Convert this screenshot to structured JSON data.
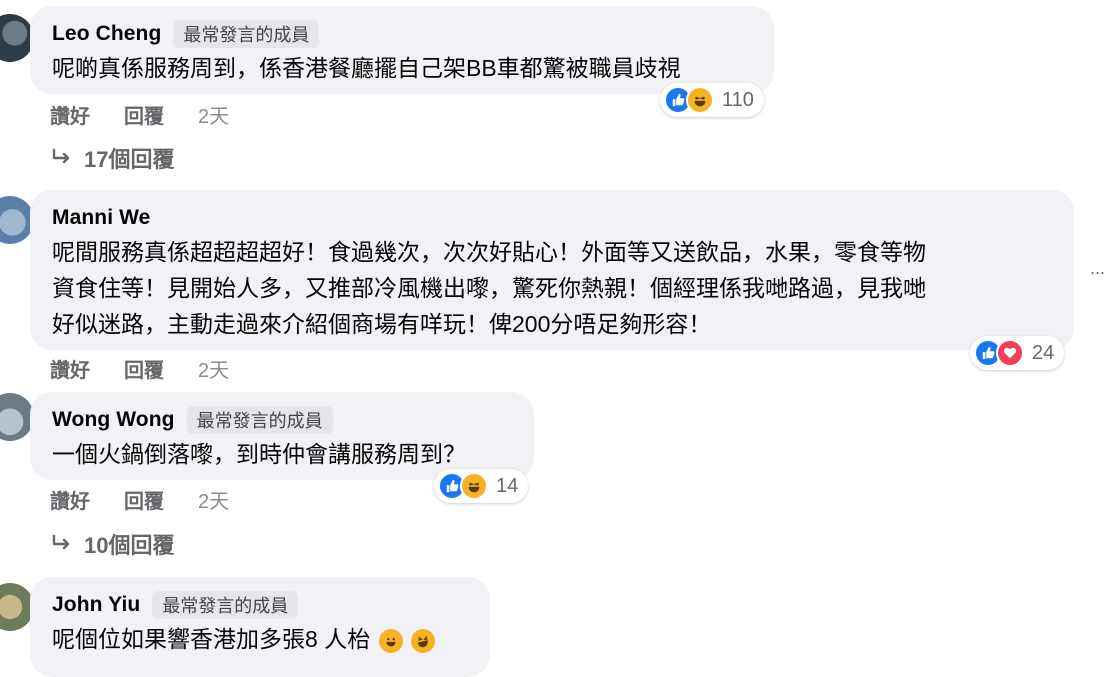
{
  "comments": [
    {
      "author": "Leo Cheng",
      "badge": "最常發言的成員",
      "text": "呢啲真係服務周到，係香港餐廳擺自己架BB車都驚被職員歧視",
      "actions": {
        "like": "讚好",
        "reply": "回覆",
        "time": "2天"
      },
      "reaction_count": "110",
      "reactions": [
        "like",
        "haha"
      ],
      "replies_label": "17個回覆"
    },
    {
      "author": "Manni We",
      "badge": "",
      "text_lines": [
        "呢間服務真係超超超超好！食過幾次，次次好貼心！外面等又送飲品，水果，零食等物",
        "資食住等！見開始人多，又推部冷風機出嚟，驚死你熱親！個經理係我哋路過，見我哋",
        "好似迷路，主動走過來介紹個商場有咩玩！俾200分唔足夠形容！"
      ],
      "actions": {
        "like": "讚好",
        "reply": "回覆",
        "time": "2天"
      },
      "reaction_count": "24",
      "reactions": [
        "like",
        "love"
      ]
    },
    {
      "author": "Wong Wong",
      "badge": "最常發言的成員",
      "text": "一個火鍋倒落嚟，到時仲會講服務周到？",
      "actions": {
        "like": "讚好",
        "reply": "回覆",
        "time": "2天"
      },
      "reaction_count": "14",
      "reactions": [
        "like",
        "haha"
      ],
      "replies_label": "10個回覆"
    },
    {
      "author": "John Yiu",
      "badge": "最常發言的成員",
      "text": "呢個位如果響香港加多張8 人枱"
    }
  ],
  "more_label": "..."
}
